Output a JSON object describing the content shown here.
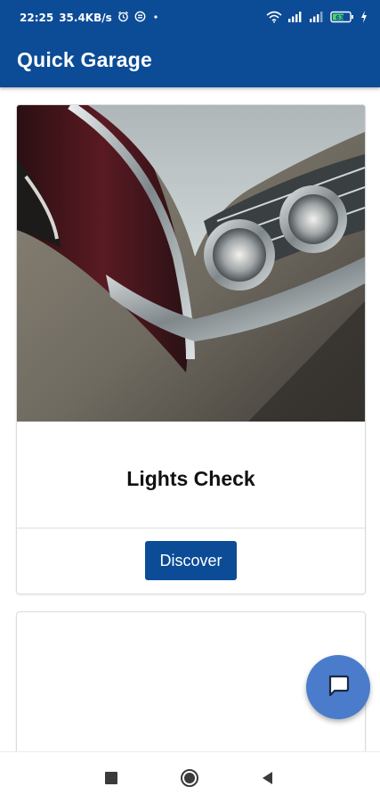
{
  "status_bar": {
    "time": "22:25",
    "network_speed": "35.4KB/s",
    "battery_level": "63",
    "icons": [
      "alarm-icon",
      "sync-icon",
      "dot-icon",
      "wifi-icon",
      "signal-icon",
      "signal-icon",
      "battery-icon",
      "charging-icon"
    ]
  },
  "app_bar": {
    "title": "Quick Garage"
  },
  "cards": [
    {
      "title": "Lights Check",
      "button_label": "Discover",
      "image": "vintage-car-headlights-photo"
    },
    {
      "title": ""
    }
  ],
  "fab": {
    "icon": "chat-icon"
  },
  "nav_bar": {
    "icons": [
      "recents-square-icon",
      "home-circle-icon",
      "back-triangle-icon"
    ]
  },
  "colors": {
    "primary": "#0c4c97",
    "fab": "#4a7ccb",
    "background": "#ffffff"
  }
}
